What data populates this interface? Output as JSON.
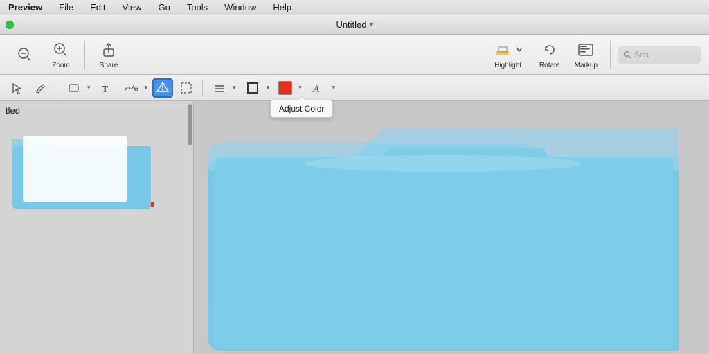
{
  "menubar": {
    "items": [
      "Preview",
      "File",
      "Edit",
      "View",
      "Go",
      "Tools",
      "Window",
      "Help"
    ]
  },
  "titlebar": {
    "title": "Untitled",
    "chevron": "▾"
  },
  "toolbar": {
    "zoom_label": "Zoom",
    "share_label": "Share",
    "highlight_label": "Highlight",
    "rotate_label": "Rotate",
    "markup_label": "Markup",
    "search_placeholder": "Sea"
  },
  "secondary_toolbar": {
    "tooltip": "Adjust Color"
  },
  "sidebar": {
    "item_label": "tled"
  },
  "colors": {
    "accent_blue": "#4a8fe8",
    "red_swatch": "#e03020",
    "folder_blue": "#78c8e8",
    "folder_blue_dark": "#6ab8d8"
  }
}
